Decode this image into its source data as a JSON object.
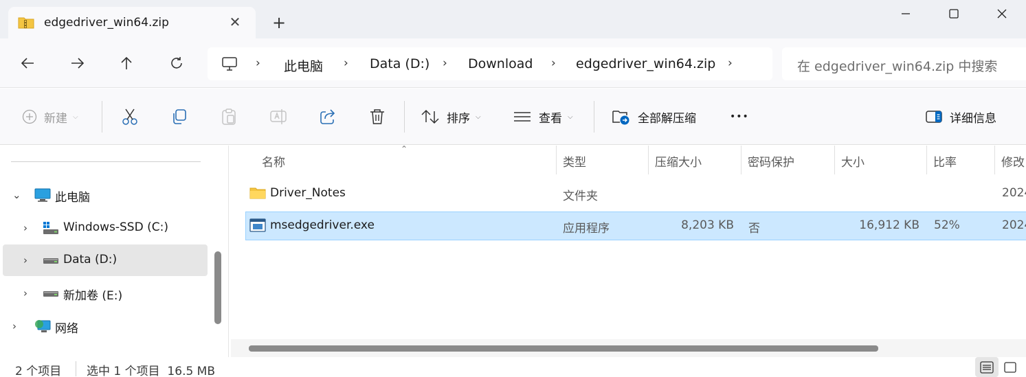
{
  "tab": {
    "title": "edgedriver_win64.zip",
    "close": "✕",
    "new_tab": "+"
  },
  "breadcrumb": {
    "items": [
      "此电脑",
      "Data (D:)",
      "Download",
      "edgedriver_win64.zip"
    ],
    "separator": "›"
  },
  "search": {
    "placeholder": "在 edgedriver_win64.zip 中搜索"
  },
  "toolbar": {
    "new_label": "新建",
    "sort_label": "排序",
    "view_label": "查看",
    "extract_all_label": "全部解压缩",
    "more_label": "•••",
    "details_label": "详细信息",
    "caret": "⌵"
  },
  "sidebar": {
    "items": [
      {
        "label": "此电脑",
        "icon": "monitor-icon"
      },
      {
        "label": "Windows-SSD (C:)",
        "icon": "windows-drive-icon"
      },
      {
        "label": "Data (D:)",
        "icon": "drive-icon"
      },
      {
        "label": "新加卷 (E:)",
        "icon": "drive-icon"
      },
      {
        "label": "网络",
        "icon": "network-icon"
      }
    ],
    "expanded_chevron": "⌄",
    "collapsed_chevron": "›"
  },
  "columns": [
    "名称",
    "类型",
    "压缩大小",
    "密码保护",
    "大小",
    "比率",
    "修改"
  ],
  "sort_indicator": "⌃",
  "files": [
    {
      "name": "Driver_Notes",
      "type": "文件夹",
      "compressed": "",
      "password": "",
      "size": "",
      "ratio": "",
      "modified": "2024",
      "icon": "folder-icon"
    },
    {
      "name": "msedgedriver.exe",
      "type": "应用程序",
      "compressed": "8,203 KB",
      "password": "否",
      "size": "16,912 KB",
      "ratio": "52%",
      "modified": "2024",
      "icon": "exe-icon"
    }
  ],
  "status": {
    "count": "2 个项目",
    "selection": "选中 1 个项目  16.5 MB"
  },
  "colors": {
    "selection": "#cce8ff",
    "selection_border": "#99d1ff",
    "accent": "#0067c0"
  }
}
